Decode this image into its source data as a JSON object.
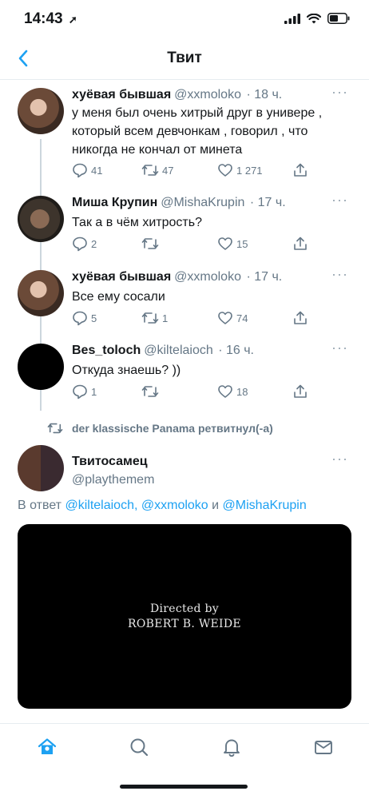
{
  "status_bar": {
    "time": "14:43"
  },
  "nav": {
    "title": "Твит"
  },
  "tweets": [
    {
      "name": "хуёвая бывшая",
      "handle": "@xxmoloko",
      "time": "· 18 ч.",
      "more": "···",
      "text": "у меня был очень хитрый друг в универе , который всем девчонкам , говорил , что никогда не кончал от минета",
      "replies": "41",
      "retweets": "47",
      "likes": "1 271"
    },
    {
      "name": "Миша Крупин",
      "handle": "@MishaKrupin",
      "time": "· 17 ч.",
      "more": "···",
      "text": "Так а в чём хитрость?",
      "replies": "2",
      "retweets": "",
      "likes": "15"
    },
    {
      "name": "хуёвая бывшая",
      "handle": "@xxmoloko",
      "time": "· 17 ч.",
      "more": "···",
      "text": "Все ему сосали",
      "replies": "5",
      "retweets": "1",
      "likes": "74"
    },
    {
      "name": "Bes_toloch",
      "handle": "@kiltelaioch",
      "time": "· 16 ч.",
      "more": "···",
      "text": "Откуда знаешь? ))",
      "replies": "1",
      "retweets": "",
      "likes": "18"
    }
  ],
  "retweet_note": "der klassische Panama ретвитнул(-а)",
  "main_tweet": {
    "name": "Твитосамец",
    "handle": "@playthemem",
    "more": "···",
    "reply_prefix": "В ответ",
    "reply_user1": "@kiltelaioch,",
    "reply_user2": "@xxmoloko",
    "reply_and": "и",
    "reply_user3": "@MishaKrupin",
    "video_line1": "Directed by",
    "video_line2": "ROBERT B. WEIDE"
  },
  "colors": {
    "accent": "#1da1f2",
    "muted": "#657786",
    "divider": "#e6ecf0"
  },
  "tabs": [
    "home-icon",
    "search-icon",
    "notifications-icon",
    "messages-icon"
  ]
}
